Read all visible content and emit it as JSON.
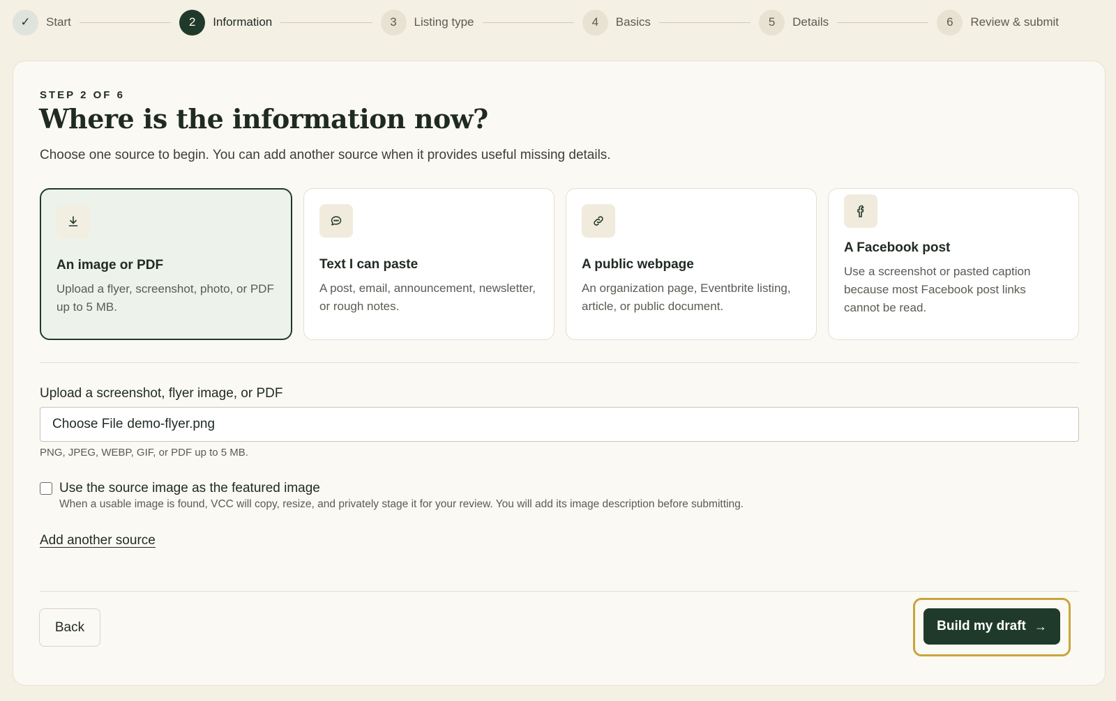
{
  "stepper": {
    "steps": [
      {
        "marker": "✓",
        "label": "Start",
        "state": "done"
      },
      {
        "marker": "2",
        "label": "Information",
        "state": "active"
      },
      {
        "marker": "3",
        "label": "Listing type",
        "state": "upcoming"
      },
      {
        "marker": "4",
        "label": "Basics",
        "state": "upcoming"
      },
      {
        "marker": "5",
        "label": "Details",
        "state": "upcoming"
      },
      {
        "marker": "6",
        "label": "Review & submit",
        "state": "upcoming"
      }
    ]
  },
  "main": {
    "eyebrow": "STEP 2 OF 6",
    "title": "Where is the information now?",
    "subtitle": "Choose one source to begin. You can add another source when it provides useful missing details."
  },
  "source_options": [
    {
      "icon": "download-icon",
      "title": "An image or PDF",
      "description": "Upload a flyer, screenshot, photo, or PDF up to 5 MB.",
      "selected": true
    },
    {
      "icon": "chat-bubble-icon",
      "title": "Text I can paste",
      "description": "A post, email, announcement, newsletter, or rough notes.",
      "selected": false
    },
    {
      "icon": "link-icon",
      "title": "A public webpage",
      "description": "An organization page, Eventbrite listing, article, or public document.",
      "selected": false
    },
    {
      "icon": "facebook-icon",
      "title": "A Facebook post",
      "description": "Use a screenshot or pasted caption because most Facebook post links cannot be read.",
      "selected": false
    }
  ],
  "upload": {
    "label": "Upload a screenshot, flyer image, or PDF",
    "button_text": "Choose File",
    "file_name": "demo-flyer.png",
    "hint": "PNG, JPEG, WEBP, GIF, or PDF up to 5 MB."
  },
  "featured_image": {
    "checked": false,
    "label": "Use the source image as the featured image",
    "help": "When a usable image is found, VCC will copy, resize, and privately stage it for your review. You will add its image description before submitting."
  },
  "add_source_link": "Add another source",
  "footer": {
    "back_label": "Back",
    "build_label": "Build my draft",
    "build_arrow": "→"
  },
  "colors": {
    "background": "#f5f0e4",
    "primary": "#1f3a2a",
    "selected_card": "#edf3ea",
    "focus_ring": "#c9a43e"
  }
}
